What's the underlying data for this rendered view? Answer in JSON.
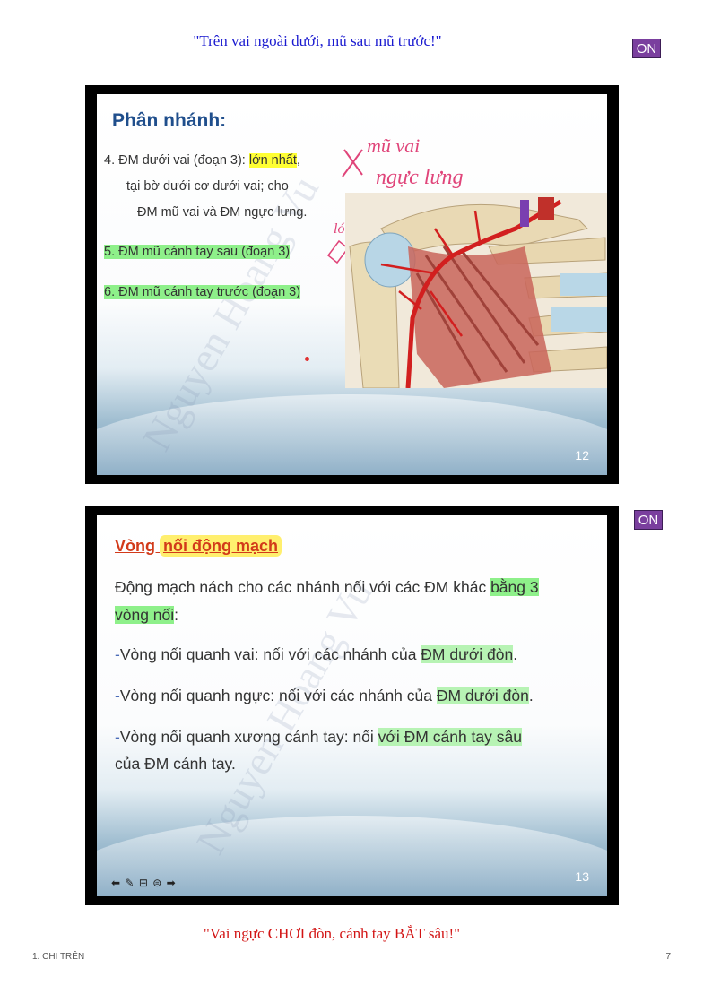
{
  "mnemonic_top": "\"Trên vai ngoài dưới, mũ sau mũ trước!\"",
  "mnemonic_bottom": "\"Vai ngực CHƠI đòn, cánh tay BẮT sâu!\"",
  "on_badge": "ON",
  "slide1": {
    "title": "Phân nhánh:",
    "item4_line1_a": "4. ĐM dưới vai (đoạn 3): ",
    "item4_line1_hl": "lớn nhất",
    "item4_line1_b": ",",
    "item4_line2": "tại bờ dưới cơ dưới vai; cho",
    "item4_line3": "ĐM mũ vai và ĐM ngực lưng.",
    "item5": "5. ĐM mũ cánh tay sau (đoạn 3)",
    "item6": "6. ĐM mũ cánh tay trước (đoạn 3)",
    "annotation_line1": "mũ vai",
    "annotation_line2": "ngực lưng",
    "annotation_small": "ló",
    "watermark": "Nguyen Hoang Vu",
    "number": "12"
  },
  "slide2": {
    "title_a": "Vòng ",
    "title_b": "nối động mạch",
    "para1_line1_a": "Động mạch nách cho các nhánh nối với các ĐM khác ",
    "para1_line1_hl": "bằng 3",
    "para1_line2_hl": "vòng nối",
    "para1_line2_b": ":",
    "dash": "-",
    "item1_a": "Vòng nối quanh vai: nối với các nhánh của ",
    "item1_hl": "ĐM dưới đòn",
    "item1_b": ".",
    "item2_a": "Vòng nối quanh ngực: nối với các nhánh của ",
    "item2_hl": "ĐM dưới đòn",
    "item2_b": ".",
    "item3_line1_a": "Vòng nối quanh xương cánh tay: nối ",
    "item3_line1_hl": "với ĐM cánh tay sâu",
    "item3_line2": "của ĐM cánh tay.",
    "watermark": "Nguyen Hoang Vu",
    "number": "13"
  },
  "footer": {
    "left": "1. CHI TRÊN",
    "right": "7"
  }
}
